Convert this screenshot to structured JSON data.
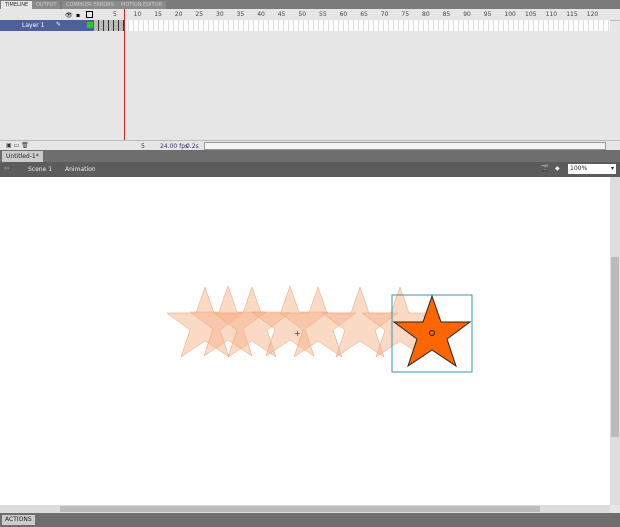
{
  "tabs": [
    "TIMELINE",
    "OUTPUT",
    "COMPILER ERRORS",
    "MOTION EDITOR"
  ],
  "ruler": [
    "5",
    "10",
    "15",
    "20",
    "25",
    "30",
    "35",
    "40",
    "45",
    "50",
    "55",
    "60",
    "65",
    "70",
    "75",
    "80",
    "85",
    "90",
    "95",
    "100",
    "105",
    "110",
    "115",
    "120"
  ],
  "layer": {
    "name": "Layer 1"
  },
  "status": {
    "frame": "5",
    "fps": "24.00 fps",
    "time": "0.2s"
  },
  "document": {
    "tab": "Untitled-1*"
  },
  "editbar": {
    "scene": "Scene 1",
    "symbol": "Animation",
    "zoom": "100%"
  },
  "panel": {
    "actions": "ACTIONS"
  },
  "colors": {
    "star": "#ff6600",
    "ghost": "#f5b48c"
  }
}
